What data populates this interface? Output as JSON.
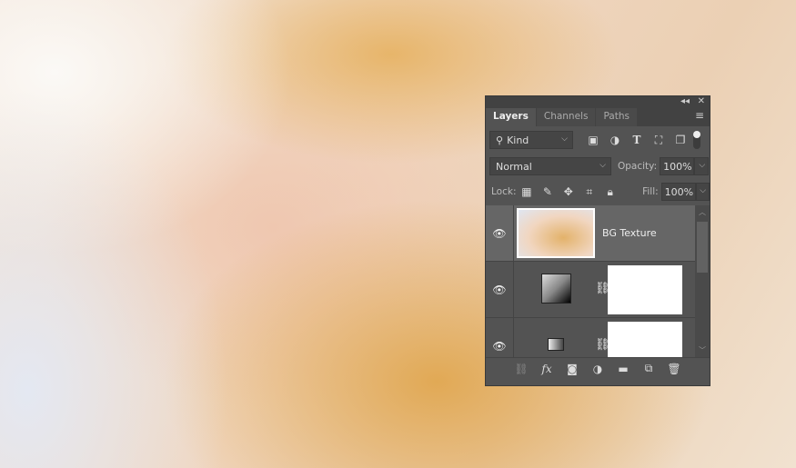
{
  "panel": {
    "tabs": [
      {
        "label": "Layers"
      },
      {
        "label": "Channels"
      },
      {
        "label": "Paths"
      }
    ],
    "filter": {
      "label": "Kind"
    },
    "blend_mode": "Normal",
    "opacity_label": "Opacity:",
    "opacity": "100%",
    "lock_label": "Lock:",
    "fill_label": "Fill:",
    "fill": "100%",
    "layers": [
      {
        "name": "BG Texture",
        "selected": true
      },
      {
        "name": "",
        "type": "gradient-map"
      },
      {
        "name": "",
        "type": "levels"
      }
    ]
  }
}
